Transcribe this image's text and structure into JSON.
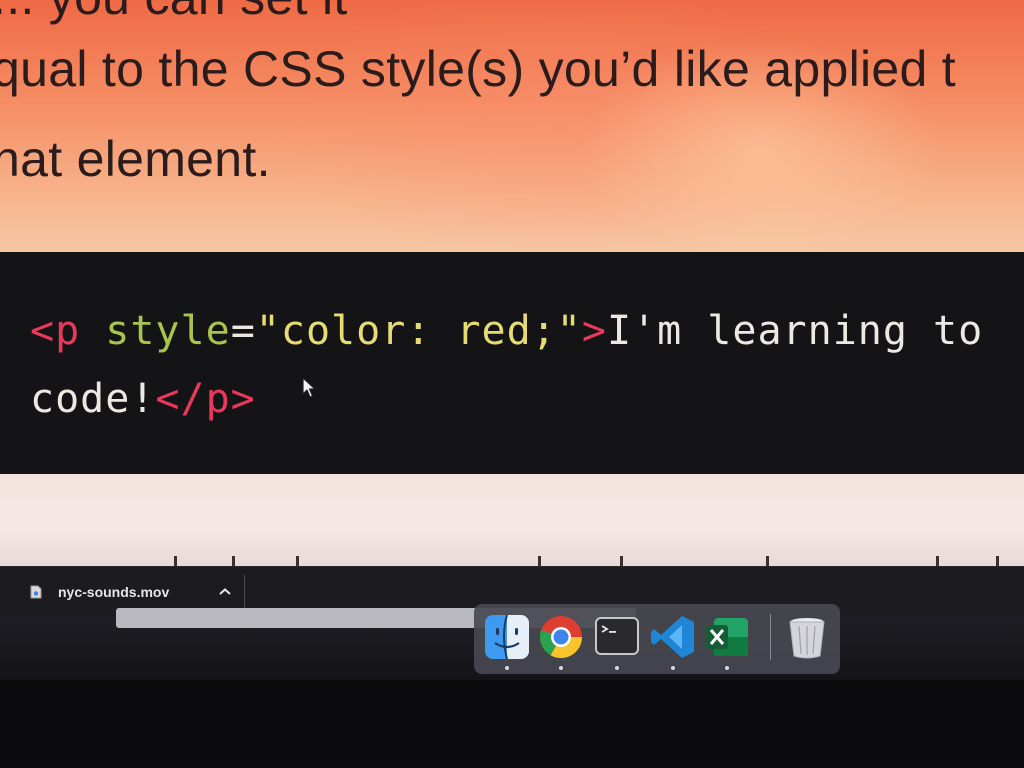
{
  "article": {
    "line_top": "... you can set it",
    "line_1": "qual to the CSS style(s) you’d like applied t",
    "line_2": "hat element."
  },
  "code": {
    "line_1": [
      {
        "cls": "tok-tag",
        "text": "<p"
      },
      {
        "cls": "tok-text",
        "text": " "
      },
      {
        "cls": "tok-attr",
        "text": "style"
      },
      {
        "cls": "tok-eq",
        "text": "="
      },
      {
        "cls": "tok-str",
        "text": "\"color: red;\""
      },
      {
        "cls": "tok-tag",
        "text": ">"
      },
      {
        "cls": "tok-text",
        "text": "I'm learning to"
      }
    ],
    "line_2": [
      {
        "cls": "tok-text",
        "text": "code!"
      },
      {
        "cls": "tok-tag",
        "text": "</p>"
      }
    ]
  },
  "download_bar": {
    "filename": "nyc-sounds.mov",
    "file_icon": "file-icon",
    "expand_icon": "chevron-up-icon"
  },
  "dock": {
    "apps": [
      "finder",
      "chrome",
      "terminal",
      "vscode",
      "excel",
      "trash"
    ],
    "running_indicators": [
      true,
      true,
      true,
      true,
      true,
      false
    ]
  },
  "colors": {
    "article_bg": "#f58c63",
    "code_bg": "#141416",
    "tag": "#e8385c",
    "attribute": "#a9c44e",
    "string": "#e7db74",
    "text": "#ece9e2",
    "dock_bg": "#46484f"
  }
}
